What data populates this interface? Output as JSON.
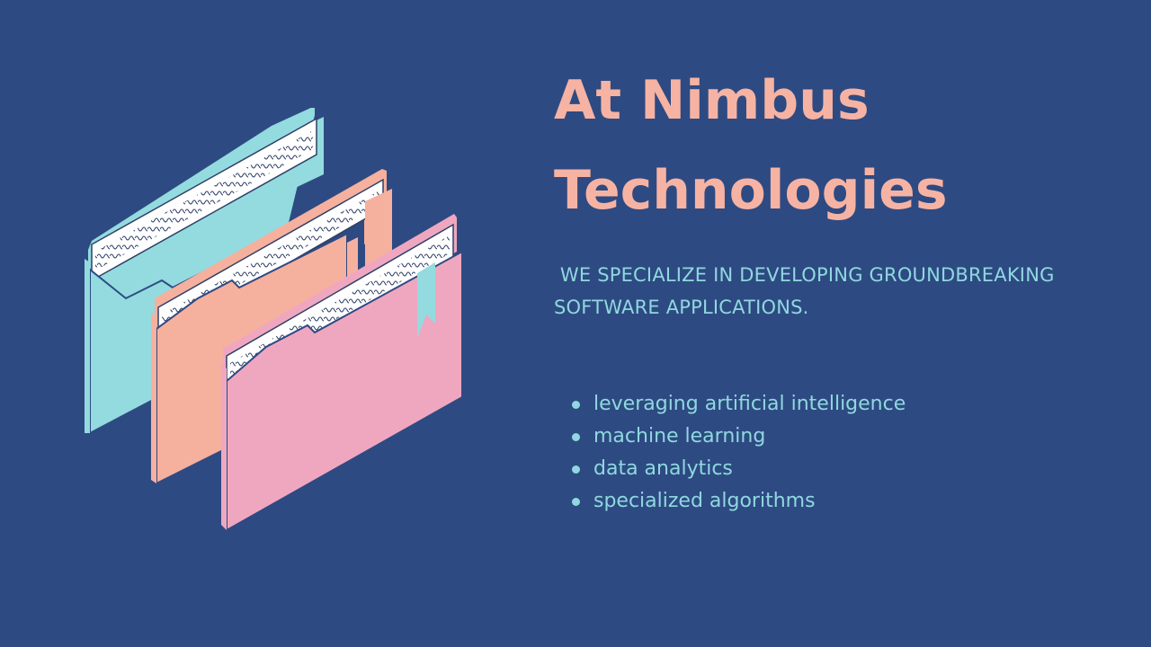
{
  "heading": {
    "line1": "At Nimbus",
    "line2": "Technologies"
  },
  "subheading": " WE SPECIALIZE IN DEVELOPING GROUNDBREAKING SOFTWARE APPLICATIONS.",
  "bullets": [
    "leveraging artificial intelligence",
    "machine learning",
    "data analytics",
    "specialized algorithms"
  ],
  "colors": {
    "background": "#2e4a82",
    "heading": "#f6b3a3",
    "body_text": "#8fd8df",
    "folder_teal": "#93dbdf",
    "folder_peach": "#f6b09e",
    "folder_pink": "#efa7c0"
  },
  "illustration": {
    "icon": "stacked-folders-icon"
  }
}
